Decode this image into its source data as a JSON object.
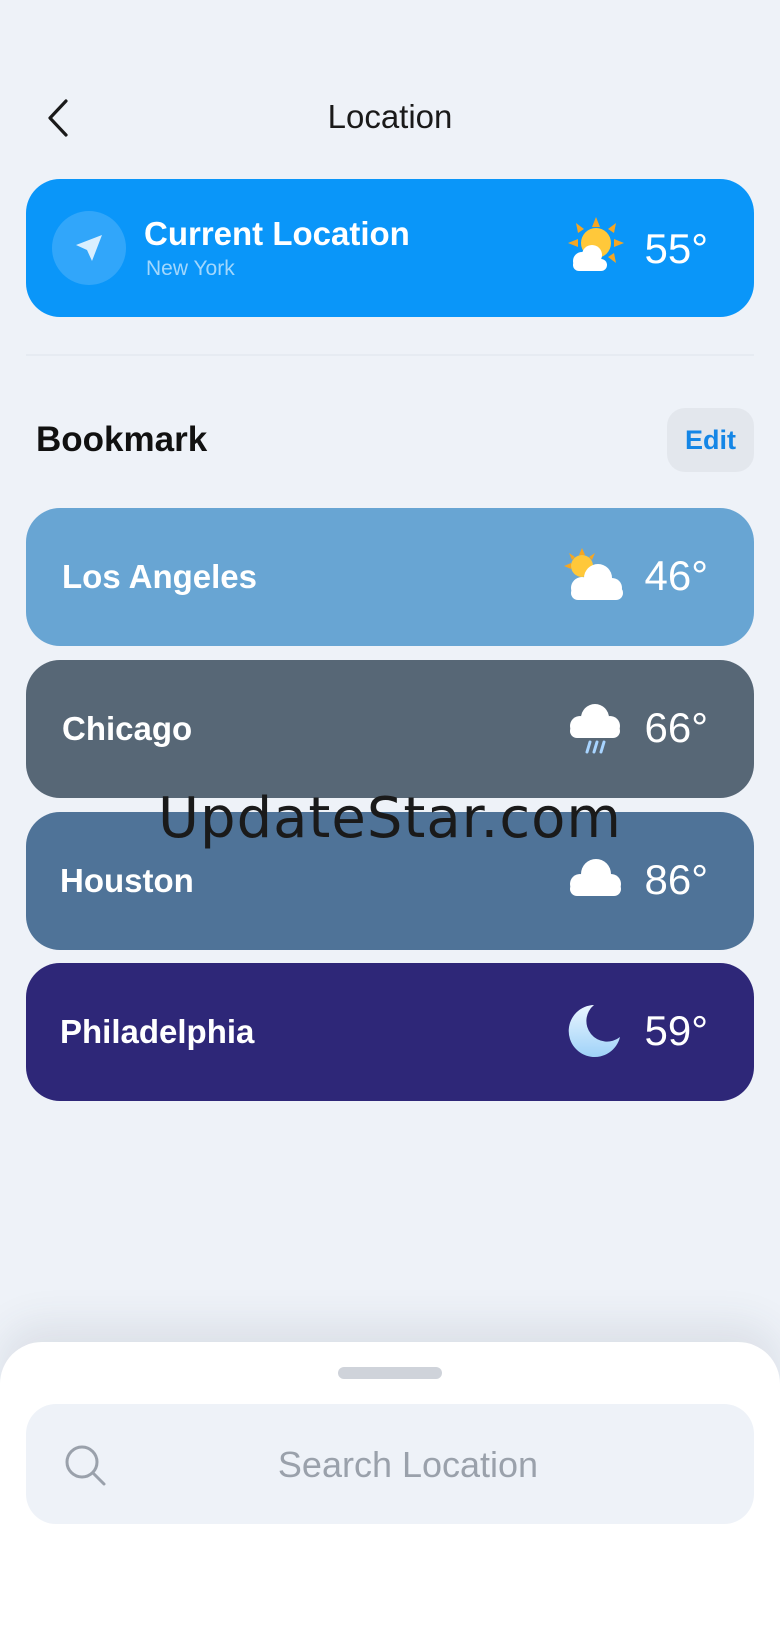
{
  "header": {
    "title": "Location",
    "back_icon": "chevron-left-icon"
  },
  "current_location": {
    "title": "Current Location",
    "city": "New York",
    "temperature": "55°",
    "weather_icon": "sun-behind-cloud-icon",
    "location_icon": "navigation-arrow-icon",
    "card_color": "#0a96f9"
  },
  "bookmark": {
    "title": "Bookmark",
    "edit_label": "Edit",
    "items": [
      {
        "name": "Los Angeles",
        "temperature": "46°",
        "weather_icon": "partly-cloudy-icon",
        "color": "#68a5d3"
      },
      {
        "name": "Chicago",
        "temperature": "66°",
        "weather_icon": "rain-cloud-icon",
        "color": "#576776"
      },
      {
        "name": "Houston",
        "temperature": "86°",
        "weather_icon": "cloud-icon",
        "color": "#4f7398"
      },
      {
        "name": "Philadelphia",
        "temperature": "59°",
        "weather_icon": "crescent-moon-icon",
        "color": "#2e2778"
      }
    ]
  },
  "watermark": "UpdateStar.com",
  "search": {
    "placeholder": "Search Location",
    "icon": "search-icon"
  }
}
